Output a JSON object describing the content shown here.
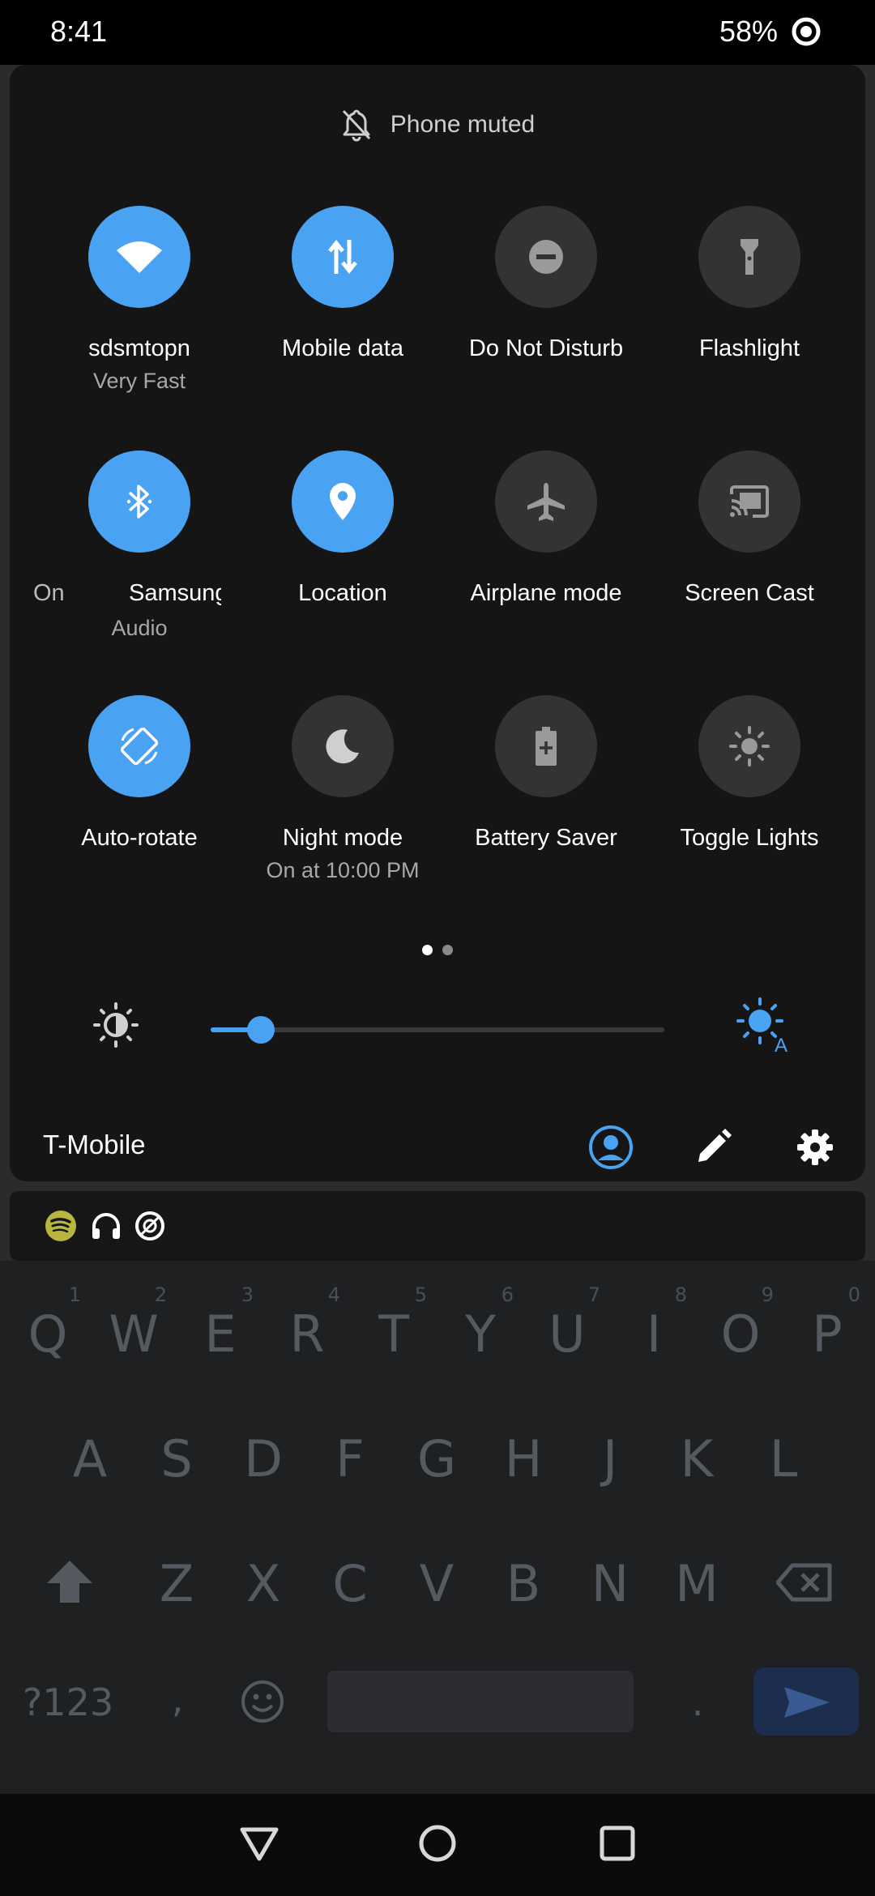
{
  "status_bar": {
    "time": "8:41",
    "battery": "58%"
  },
  "notice": {
    "text": "Phone muted",
    "icon": "bell-off-icon"
  },
  "tiles": [
    {
      "label": "sdsmtopn",
      "sub": "Very Fast",
      "icon": "wifi-icon",
      "active": true
    },
    {
      "label": "Mobile data",
      "sub": "",
      "icon": "mobile-data-icon",
      "active": true
    },
    {
      "label": "Do Not Disturb",
      "sub": "",
      "icon": "dnd-icon",
      "active": false
    },
    {
      "label": "Flashlight",
      "sub": "",
      "icon": "flashlight-icon",
      "active": false
    },
    {
      "label_left": "On",
      "label": "Samsung",
      "sub": "Audio",
      "icon": "bluetooth-icon",
      "active": true
    },
    {
      "label": "Location",
      "sub": "",
      "icon": "location-icon",
      "active": true
    },
    {
      "label": "Airplane mode",
      "sub": "",
      "icon": "airplane-icon",
      "active": false
    },
    {
      "label": "Screen Cast",
      "sub": "",
      "icon": "cast-icon",
      "active": false
    },
    {
      "label": "Auto-rotate",
      "sub": "",
      "icon": "auto-rotate-icon",
      "active": true
    },
    {
      "label": "Night mode",
      "sub": "On at 10:00 PM",
      "icon": "moon-icon",
      "active": false
    },
    {
      "label": "Battery Saver",
      "sub": "",
      "icon": "battery-saver-icon",
      "active": false
    },
    {
      "label": "Toggle Lights",
      "sub": "",
      "icon": "light-icon",
      "active": false
    }
  ],
  "pager": {
    "count": 2,
    "current": 0
  },
  "brightness": {
    "level": 0.11
  },
  "footer": {
    "carrier": "T-Mobile"
  },
  "keyboard": {
    "row1": [
      "Q",
      "W",
      "E",
      "R",
      "T",
      "Y",
      "U",
      "I",
      "O",
      "P"
    ],
    "row1_hints": [
      "1",
      "2",
      "3",
      "4",
      "5",
      "6",
      "7",
      "8",
      "9",
      "0"
    ],
    "row2": [
      "A",
      "S",
      "D",
      "F",
      "G",
      "H",
      "J",
      "K",
      "L"
    ],
    "row3": [
      "Z",
      "X",
      "C",
      "V",
      "B",
      "N",
      "M"
    ],
    "symbols_key": "?123",
    "comma": ",",
    "period": "."
  },
  "colors": {
    "accent": "#4aa3f2",
    "panel": "#151515",
    "tile_off": "#333333"
  }
}
